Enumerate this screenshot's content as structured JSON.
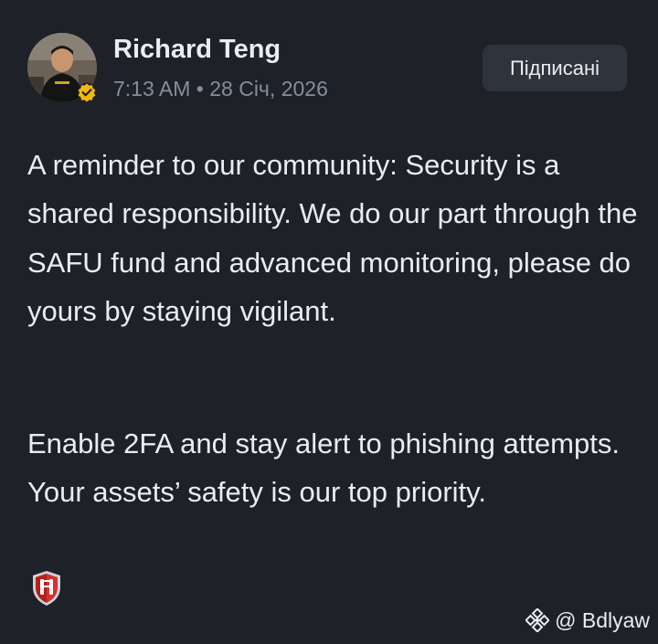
{
  "author": {
    "name": "Richard Teng",
    "avatar_icon": "avatar",
    "verified_icon": "verified-badge-icon",
    "verified_color": "#F0B90B"
  },
  "post_meta": {
    "time": "7:13 AM",
    "separator": "•",
    "date": "28 Січ, 2026"
  },
  "follow_button": {
    "label": "Підписані"
  },
  "post": {
    "paragraphs": [
      "A reminder to our community: Security is a shared responsibility. We do our part through the SAFU fund and advanced monitoring, please do yours by staying vigilant.",
      "Enable 2FA and stay alert to phishing attempts. Your assets’ safety is our top priority."
    ],
    "emoji_icon": "shield-emoji-icon"
  },
  "watermark": {
    "text": "@ Bdlyaw",
    "icon": "binance-logo-icon"
  },
  "colors": {
    "background": "#1E2128",
    "text_primary": "#EAECEF",
    "text_secondary": "#848E9C",
    "button_bg": "#2F333C",
    "brand": "#F0B90B"
  }
}
